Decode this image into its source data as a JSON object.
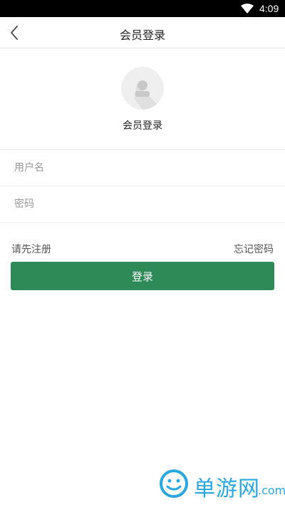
{
  "status_bar": {
    "time": "4:09",
    "icons": [
      "wifi-icon",
      "battery-icon"
    ]
  },
  "header": {
    "title": "会员登录",
    "back_icon": "chevron-left-icon"
  },
  "profile": {
    "avatar_icon": "user-icon",
    "caption": "会员登录"
  },
  "form": {
    "username_placeholder": "用户名",
    "password_placeholder": "密码",
    "register_link": "请先注册",
    "forgot_link": "忘记密码",
    "login_button": "登录"
  },
  "watermark": {
    "brand": "单游网",
    "domain_suffix": ".com"
  },
  "colors": {
    "primary": "#2e8b57",
    "watermark": "#29a8e0",
    "divider": "#eeeeee"
  }
}
